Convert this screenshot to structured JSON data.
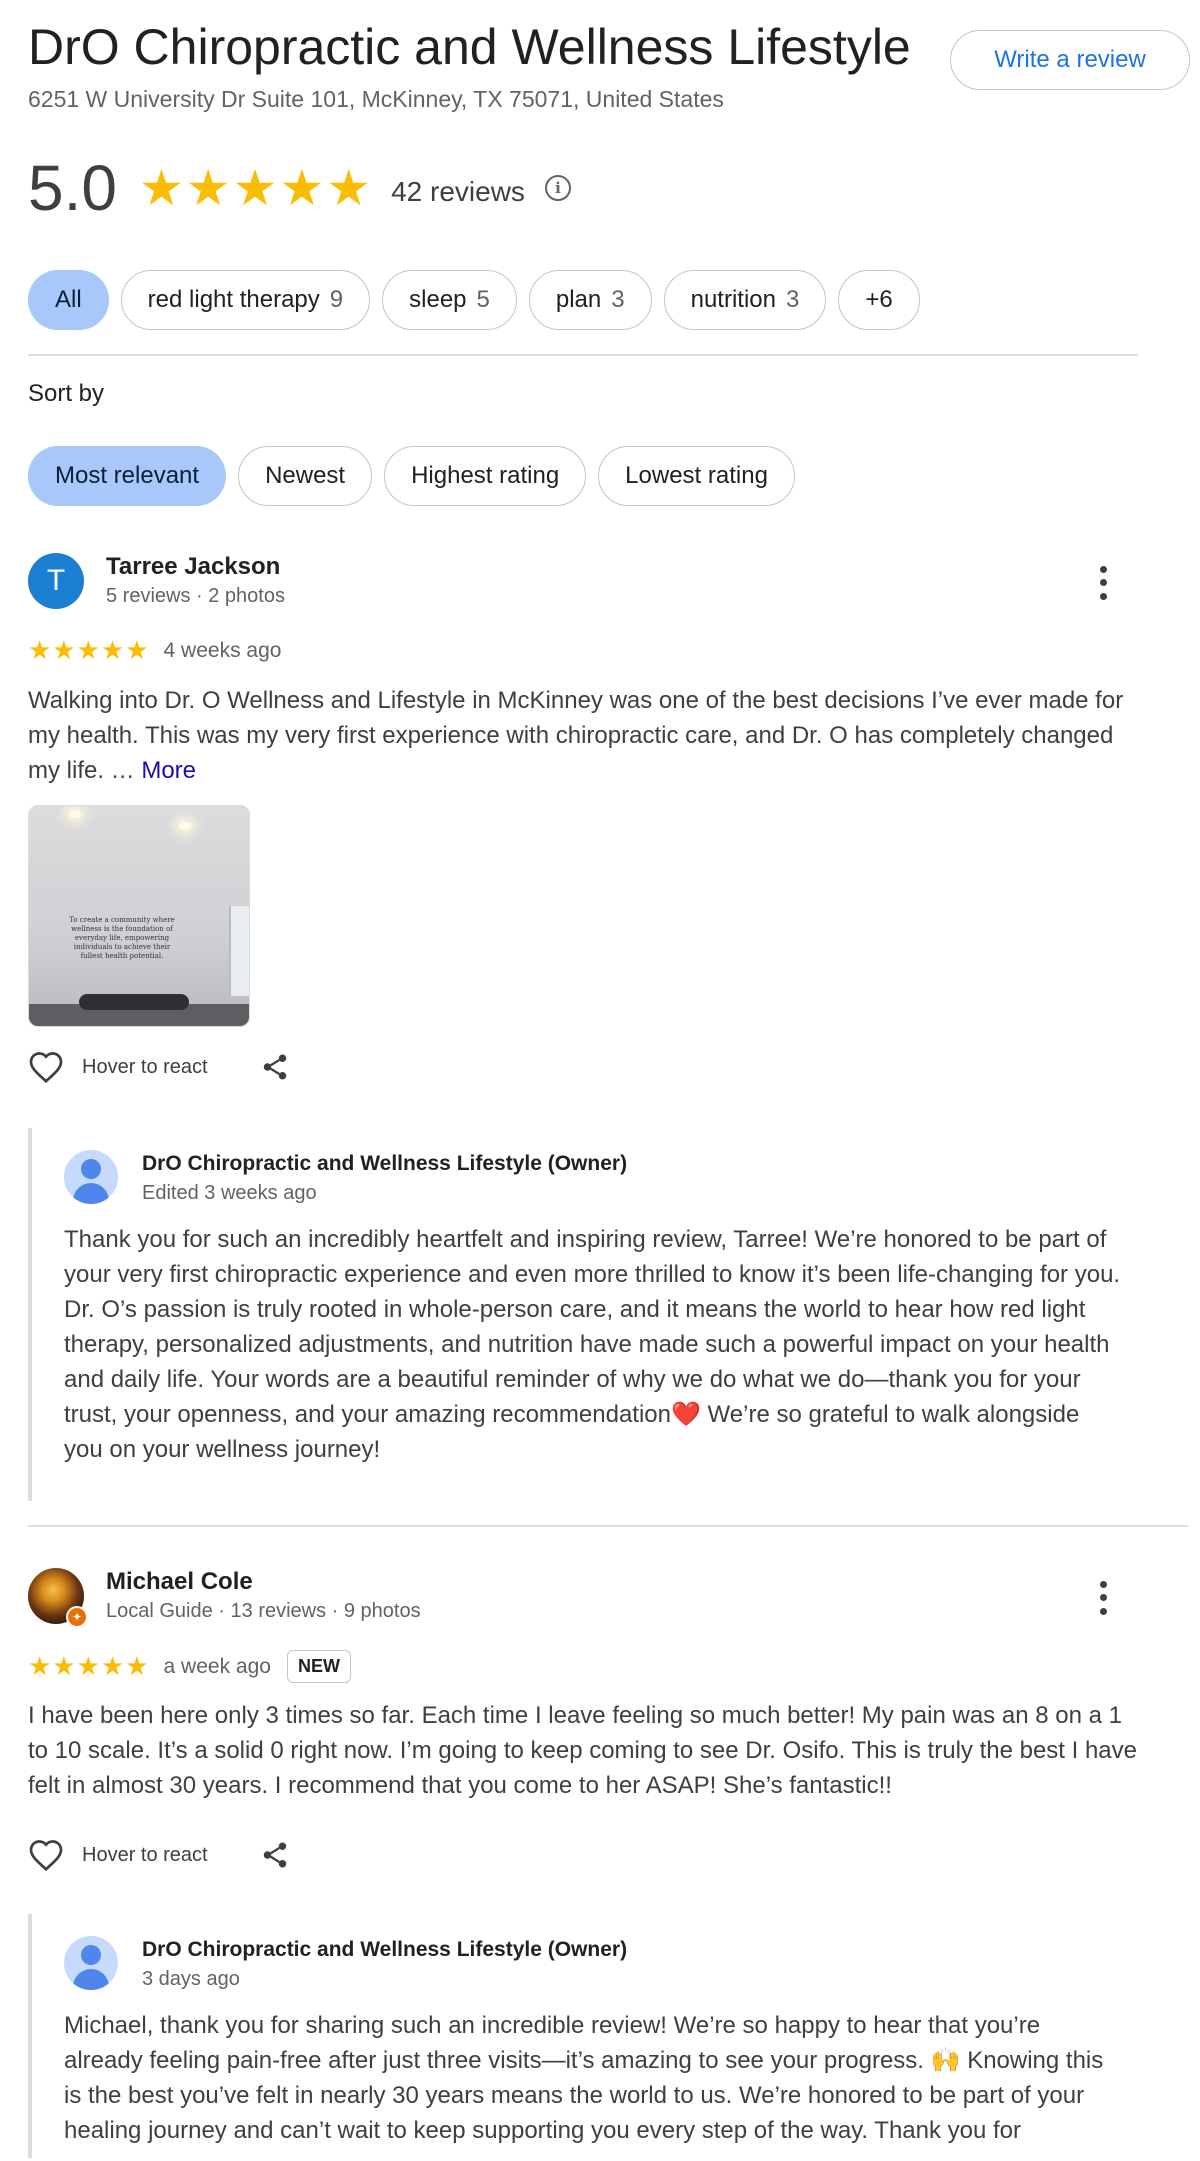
{
  "header": {
    "business_name": "DrO Chiropractic and Wellness Lifestyle",
    "address": "6251 W University Dr Suite 101, McKinney, TX 75071, United States",
    "write_review_label": "Write a review"
  },
  "summary": {
    "rating": "5.0",
    "stars": "★★★★★",
    "review_count": "42 reviews",
    "info_icon": "i"
  },
  "topic_filters": [
    {
      "label": "All",
      "count": "",
      "active": true
    },
    {
      "label": "red light therapy",
      "count": "9",
      "active": false
    },
    {
      "label": "sleep",
      "count": "5",
      "active": false
    },
    {
      "label": "plan",
      "count": "3",
      "active": false
    },
    {
      "label": "nutrition",
      "count": "3",
      "active": false
    },
    {
      "label": "+6",
      "count": "",
      "active": false
    }
  ],
  "sort": {
    "label": "Sort by",
    "options": [
      {
        "label": "Most relevant",
        "active": true
      },
      {
        "label": "Newest",
        "active": false
      },
      {
        "label": "Highest rating",
        "active": false
      },
      {
        "label": "Lowest rating",
        "active": false
      }
    ]
  },
  "reviews": [
    {
      "avatar_letter": "T",
      "avatar_color": "#1a7fd1",
      "name": "Tarree Jackson",
      "meta": "5 reviews · 2 photos",
      "stars": "★★★★★",
      "time": "4 weeks ago",
      "badge": "",
      "text": "Walking into Dr. O Wellness and Lifestyle in McKinney was one of the best decisions I’ve ever made for my health. This was my very first experience with chiropractic care, and Dr. O has completely changed my life. … ",
      "more_label": "More",
      "photo_caption": "To create a community where wellness is the foundation of everyday life, empowering individuals to achieve their fullest health potential.",
      "react_label": "Hover to react",
      "owner_reply": {
        "name": "DrO Chiropractic and Wellness Lifestyle (Owner)",
        "date": "Edited 3 weeks ago",
        "text": "Thank you for such an incredibly heartfelt and inspiring review, Tarree! We’re honored to be part of your very first chiropractic experience and even more thrilled to know it’s been life-changing for you. Dr. O’s passion is truly rooted in whole-person care, and it means the world to hear how red light therapy, personalized adjustments, and nutrition have made such a powerful impact on your health and daily life. Your words are a beautiful reminder of why we do what we do—thank you for your trust, your openness, and your amazing recommendation❤️ We’re so grateful to walk alongside you on your wellness journey!"
      }
    },
    {
      "avatar_letter": "",
      "avatar_color": "#8a4a1c",
      "name": "Michael Cole",
      "meta": "Local Guide · 13 reviews · 9 photos",
      "stars": "★★★★★",
      "time": "a week ago",
      "badge": "NEW",
      "text": "I have been here only 3 times so far. Each time I leave feeling so much better! My pain was an 8 on a 1 to 10 scale. It’s a solid 0 right now. I’m going to keep coming to see Dr. Osifo. This is truly the best I have felt in almost 30 years. I recommend that you come to her ASAP! She’s fantastic!!",
      "react_label": "Hover to react",
      "owner_reply": {
        "name": "DrO Chiropractic and Wellness Lifestyle (Owner)",
        "date": "3 days ago",
        "text": "Michael, thank you for sharing such an incredible review! We’re so happy to hear that you’re already feeling pain-free after just three visits—it’s amazing to see your progress. 🙌 Knowing this is the best you’ve felt in nearly 30 years means the world to us. We’re honored to be part of your healing journey and can’t wait to keep supporting you every step of the way. Thank you for"
      }
    }
  ]
}
